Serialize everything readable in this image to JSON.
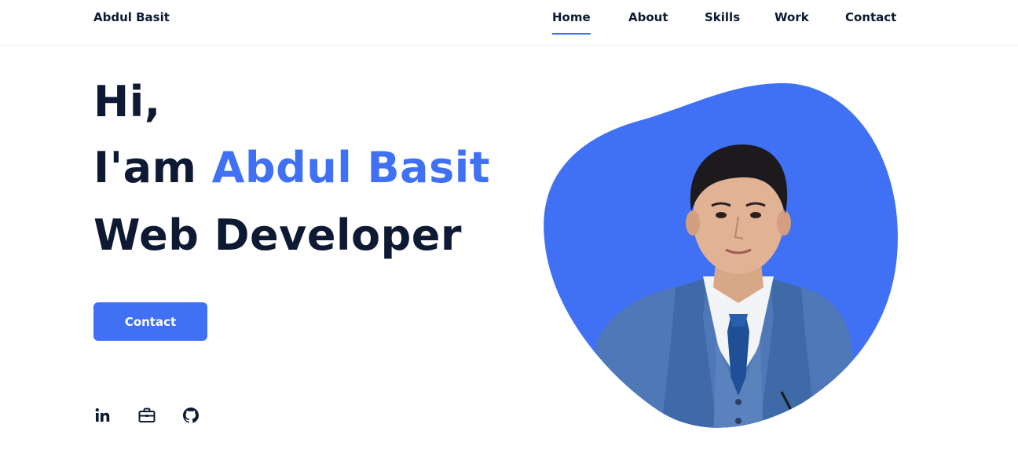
{
  "header": {
    "brand": "Abdul Basit",
    "nav": [
      {
        "label": "Home",
        "active": true
      },
      {
        "label": "About",
        "active": false
      },
      {
        "label": "Skills",
        "active": false
      },
      {
        "label": "Work",
        "active": false
      },
      {
        "label": "Contact",
        "active": false
      }
    ]
  },
  "hero": {
    "greeting": "Hi,",
    "intro_prefix": "I'am",
    "name": "Abdul Basit",
    "role": "Web Developer",
    "cta_label": "Contact"
  },
  "social_icons": [
    "linkedin-icon",
    "briefcase-icon",
    "github-icon"
  ],
  "colors": {
    "accent": "#4070f4",
    "text": "#0e1a33",
    "background": "#ffffff"
  }
}
